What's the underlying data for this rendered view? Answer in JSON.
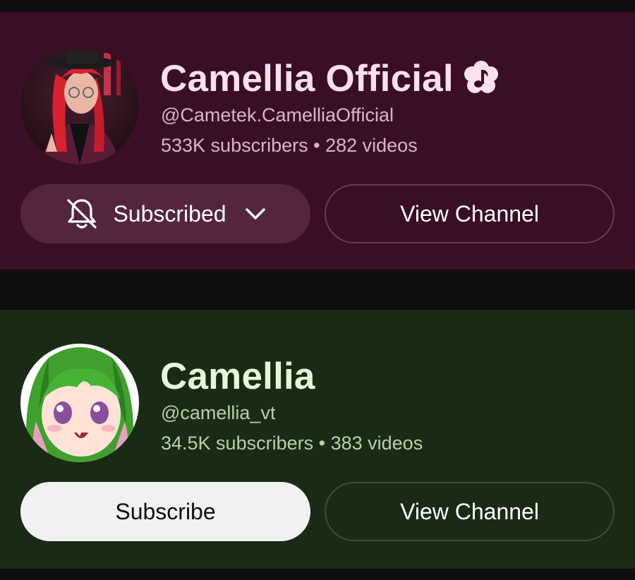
{
  "channels": [
    {
      "name": "Camellia Official",
      "verified": true,
      "verified_icon": "music-verified-badge-icon",
      "handle": "@Cametek.CamelliaOfficial",
      "subscribers": "533K subscribers",
      "separator": "•",
      "videos": "282 videos",
      "subscription_button": {
        "label": "Subscribed",
        "state": "subscribed",
        "icon": "bell-off-icon",
        "dropdown_icon": "chevron-down-icon"
      },
      "view_button": {
        "label": "View Channel"
      },
      "theme": {
        "background": "#3a0f26",
        "accent": "#fbe0ee"
      }
    },
    {
      "name": "Camellia",
      "verified": false,
      "handle": "@camellia_vt",
      "subscribers": "34.5K subscribers",
      "separator": "•",
      "videos": "383 videos",
      "subscription_button": {
        "label": "Subscribe",
        "state": "not-subscribed"
      },
      "view_button": {
        "label": "View Channel"
      },
      "theme": {
        "background": "#1a2b15",
        "accent": "#e4f7d8"
      }
    }
  ]
}
